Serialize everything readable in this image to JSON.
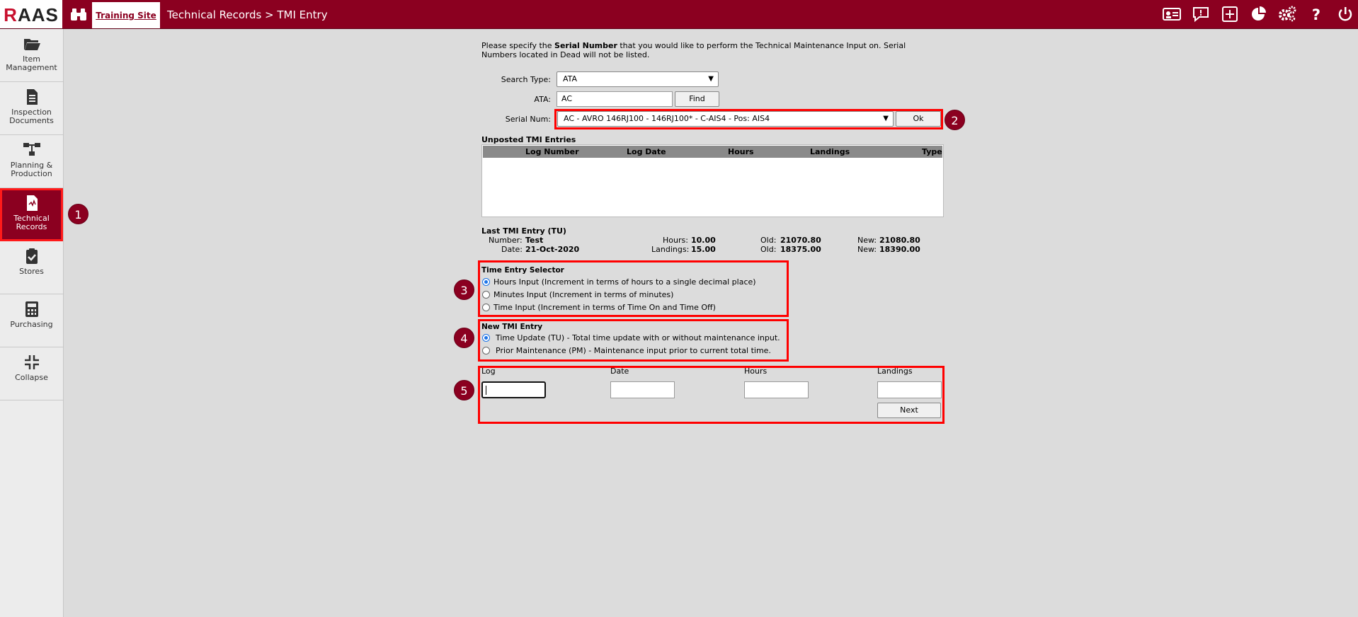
{
  "app": {
    "logo": "RAAS",
    "site_tab": "Training Site",
    "breadcrumb": "Technical Records > TMI Entry"
  },
  "top_icons": [
    "id-card-icon",
    "chat-icon",
    "add-icon",
    "pie-chart-icon",
    "gears-icon",
    "help-icon",
    "power-icon"
  ],
  "sidebar": {
    "items": [
      {
        "label": "Item Management",
        "icon": "folder-icon"
      },
      {
        "label": "Inspection Documents",
        "icon": "document-icon"
      },
      {
        "label": "Planning & Production",
        "icon": "hierarchy-icon"
      },
      {
        "label": "Technical Records",
        "icon": "tech-records-icon",
        "active": true
      },
      {
        "label": "Stores",
        "icon": "clipboard-check-icon"
      },
      {
        "label": "Purchasing",
        "icon": "calculator-icon"
      },
      {
        "label": "Collapse",
        "icon": "collapse-icon"
      }
    ]
  },
  "intro": {
    "before": "Please specify the ",
    "bold": "Serial Number",
    "after": " that you would like to perform the Technical Maintenance Input on. Serial Numbers located in Dead will not be listed."
  },
  "form": {
    "search_type_label": "Search Type:",
    "search_type_value": "ATA",
    "ata_label": "ATA:",
    "ata_value": "AC",
    "find_label": "Find",
    "serial_label": "Serial Num:",
    "serial_value": "AC - AVRO 146RJ100 - 146RJ100* - C-AIS4 - Pos: AIS4",
    "ok_label": "Ok"
  },
  "unposted": {
    "title": "Unposted TMI Entries",
    "columns": [
      "Log Number",
      "Log Date",
      "Hours",
      "Landings",
      "Type"
    ],
    "rows": []
  },
  "last_tmi": {
    "title": "Last TMI Entry (TU)",
    "number_label": "Number:",
    "number_value": "Test",
    "date_label": "Date:",
    "date_value": "21-Oct-2020",
    "hours_label": "Hours:",
    "hours_value": "10.00",
    "landings_label": "Landings:",
    "landings_value": "15.00",
    "old_label": "Old:",
    "old_hours": "21070.80",
    "old_landings": "18375.00",
    "new_label": "New:",
    "new_hours": "21080.80",
    "new_landings": "18390.00"
  },
  "time_entry": {
    "title": "Time Entry Selector",
    "options": [
      {
        "label": "Hours Input (Increment in terms of hours to a single decimal place)",
        "selected": true
      },
      {
        "label": "Minutes Input (Increment in terms of minutes)",
        "selected": false
      },
      {
        "label": "Time Input (Increment in terms of Time On and Time Off)",
        "selected": false
      }
    ]
  },
  "new_tmi": {
    "title": "New TMI Entry",
    "options": [
      {
        "label": "Time Update (TU) - Total time update with or without maintenance input.",
        "selected": true
      },
      {
        "label": "Prior Maintenance (PM) - Maintenance input prior to current total time.",
        "selected": false
      }
    ]
  },
  "entry": {
    "columns": [
      "Log",
      "Date",
      "Hours",
      "Landings"
    ],
    "values": [
      "",
      "",
      "",
      ""
    ],
    "next_label": "Next"
  },
  "badges": [
    "1",
    "2",
    "3",
    "4",
    "5"
  ],
  "colors": {
    "brand": "#8b0020",
    "highlight": "#ff0000",
    "radio_selected": "#1a73e8"
  }
}
